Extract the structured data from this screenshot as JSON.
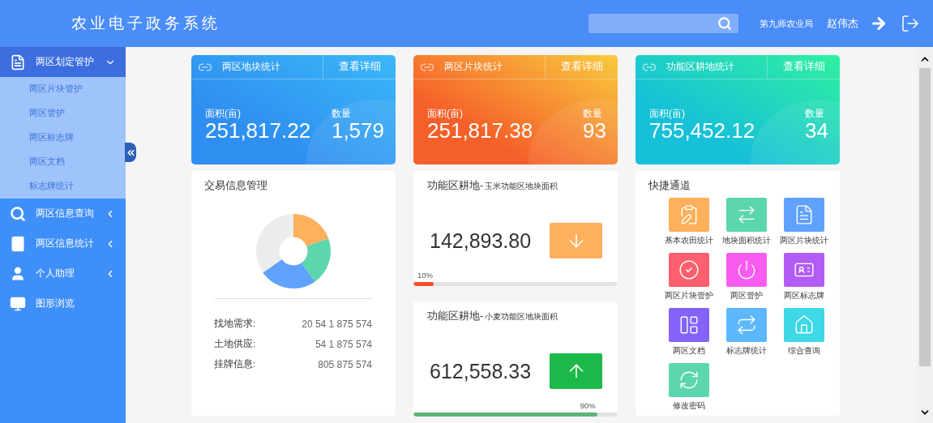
{
  "header": {
    "title": "农业电子政务系统",
    "org": "第九师农业局",
    "user": "赵伟杰"
  },
  "sidebar": {
    "items": [
      {
        "label": "两区划定管护",
        "kind": "group",
        "selected": true,
        "expanded": true,
        "children": [
          {
            "label": "两区片块管护"
          },
          {
            "label": "两区管护"
          },
          {
            "label": "两区标志牌"
          },
          {
            "label": "两区文档"
          },
          {
            "label": "标志牌统计"
          }
        ]
      },
      {
        "label": "两区信息查询",
        "kind": "group",
        "selected": false,
        "expanded": false
      },
      {
        "label": "两区信息统计",
        "kind": "group",
        "selected": false,
        "expanded": false
      },
      {
        "label": "个人助理",
        "kind": "group",
        "selected": false,
        "expanded": false
      },
      {
        "label": "图形浏览",
        "kind": "link",
        "selected": false
      }
    ]
  },
  "stat_cards": [
    {
      "title": "两区地块统计",
      "link": "查看详细",
      "area_label": "面积(亩)",
      "area": "251,817.22",
      "count_label": "数量",
      "count": "1,579",
      "color": "#2f8ff0"
    },
    {
      "title": "两区片块统计",
      "link": "查看详细",
      "area_label": "面积(亩)",
      "area": "251,817.38",
      "count_label": "数量",
      "count": "93",
      "color": "#f5602a"
    },
    {
      "title": "功能区耕地统计",
      "link": "查看详细",
      "area_label": "面积(亩)",
      "area": "755,452.12",
      "count_label": "数量",
      "count": "34",
      "color": "#16c0d8"
    }
  ],
  "trade_panel": {
    "title": "交易信息管理",
    "rows": [
      {
        "label": "找地需求:",
        "value": "20 54 1 875 574"
      },
      {
        "label": "土地供应:",
        "value": "54 1 875 574"
      },
      {
        "label": "挂牌信息:",
        "value": "805 875 574"
      }
    ]
  },
  "metric_cards": [
    {
      "title": "功能区耕地-",
      "subtitle": "玉米功能区地块面积",
      "value": "142,893.80",
      "kind": "down",
      "percent": "10%",
      "level": 0.1
    },
    {
      "title": "功能区耕地-",
      "subtitle": "小麦功能区地块面积",
      "value": "612,558.33",
      "kind": "up",
      "percent": "90%",
      "level": 0.9
    }
  ],
  "quick_links": {
    "title": "快捷通道",
    "items": [
      {
        "label": "基本农田统计",
        "color": "#ffb05c"
      },
      {
        "label": "地块面积统计",
        "color": "#5cd6ae"
      },
      {
        "label": "两区片块统计",
        "color": "#5ea2fb"
      },
      {
        "label": "两区片块管护",
        "color": "#ff5f6e"
      },
      {
        "label": "两区管护",
        "color": "#fb5cf0"
      },
      {
        "label": "两区标志牌",
        "color": "#b35cf5"
      },
      {
        "label": "两区文档",
        "color": "#8463fb"
      },
      {
        "label": "标志牌统计",
        "color": "#5cb8fb"
      },
      {
        "label": "综合查询",
        "color": "#3ed8e6"
      },
      {
        "label": "修改密码",
        "color": "#5cd6ae"
      }
    ]
  }
}
